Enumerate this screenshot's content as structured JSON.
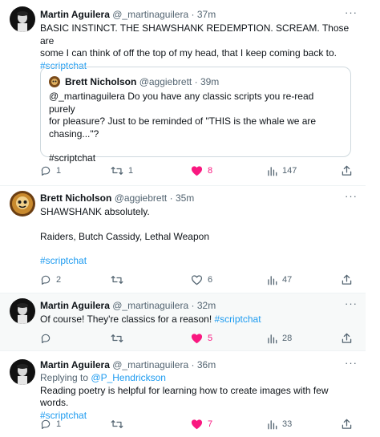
{
  "tweets": [
    {
      "name": "Martin Aguilera",
      "handle": "@_martinaguilera",
      "sep": "·",
      "time": "37m",
      "more": "···",
      "text_line1": "BASIC INSTINCT. THE SHAWSHANK REDEMPTION. SCREAM. Those are",
      "text_line2": "some I can think of off the top of my head, that I keep coming back to.",
      "hashtag": "#scriptchat",
      "quote": {
        "name": "Brett Nicholson",
        "handle": "@aggiebrett",
        "sep": "·",
        "time": "39m",
        "line1": "@_martinaguilera  Do you have any classic scripts you re-read purely",
        "line2": "for pleasure? Just to be reminded of \"THIS is the whale we are",
        "line3": "chasing...\"?",
        "hashtag": "#scriptchat"
      },
      "replies": "1",
      "retweets": "1",
      "likes": "8",
      "views": "147"
    },
    {
      "name": "Brett Nicholson",
      "handle": "@aggiebrett",
      "sep": "·",
      "time": "35m",
      "more": "···",
      "line1": "SHAWSHANK absolutely.",
      "line2": "Raiders, Butch Cassidy, Lethal Weapon",
      "hashtag": "#scriptchat",
      "replies": "2",
      "retweets": "",
      "likes": "6",
      "views": "47"
    },
    {
      "name": "Martin Aguilera",
      "handle": "@_martinaguilera",
      "sep": "·",
      "time": "32m",
      "more": "···",
      "text": "Of course! They're classics for a reason!",
      "hashtag": "#scriptchat",
      "replies": "",
      "retweets": "",
      "likes": "5",
      "views": "28"
    },
    {
      "name": "Martin Aguilera",
      "handle": "@_martinaguilera",
      "sep": "·",
      "time": "36m",
      "more": "···",
      "replying_prefix": "Replying to",
      "replying_to": "@P_Hendrickson",
      "text": "Reading poetry is helpful for learning how to create images with few words.",
      "hashtag": "#scriptchat",
      "replies": "1",
      "retweets": "",
      "likes": "7",
      "views": "33"
    }
  ],
  "colors": {
    "accent": "#1d9bf0",
    "like": "#f91880",
    "muted": "#536471",
    "highlight_bg": "#f7f9f9"
  }
}
